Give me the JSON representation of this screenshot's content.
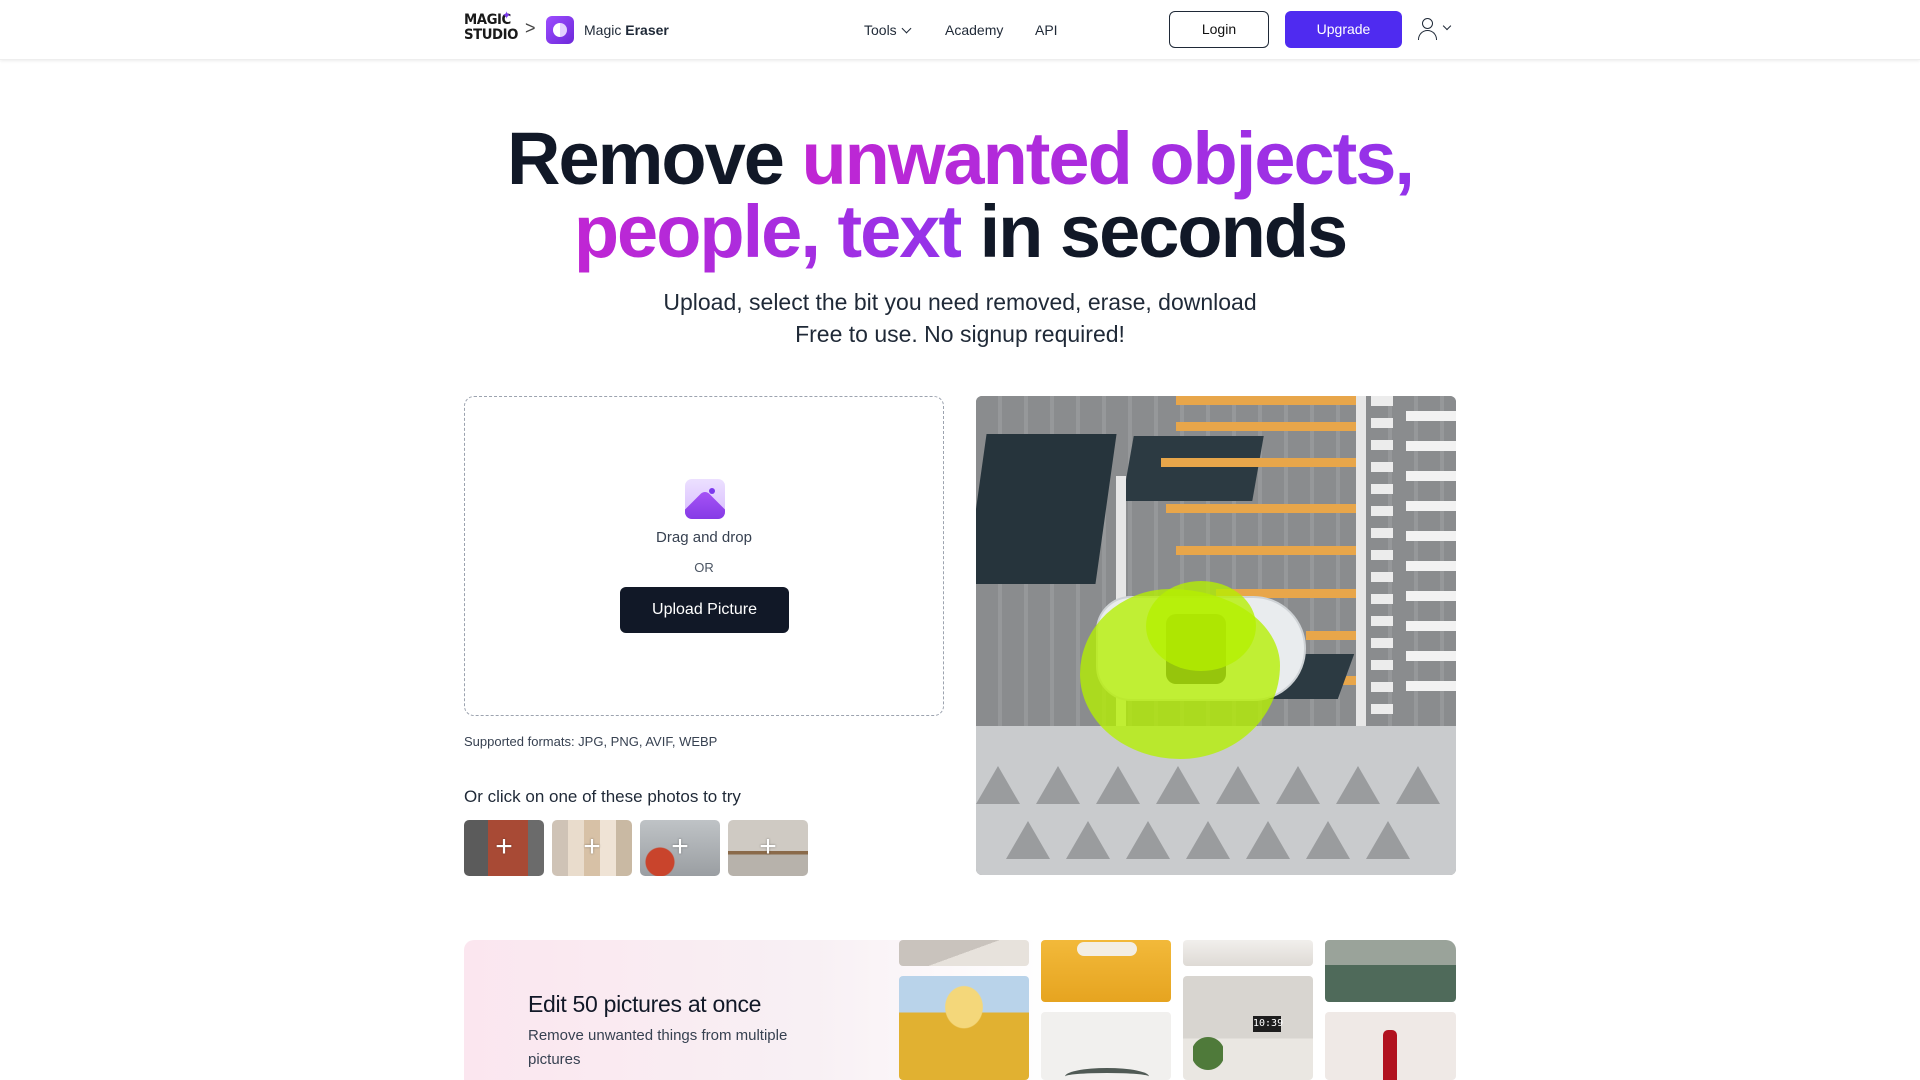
{
  "header": {
    "logo_line1": "MAGIC",
    "logo_line2": "STUDIO",
    "breadcrumb_separator": ">",
    "app_name_light": "Magic",
    "app_name_bold": "Eraser",
    "nav": {
      "tools": "Tools",
      "academy": "Academy",
      "api": "API"
    },
    "login": "Login",
    "upgrade": "Upgrade",
    "icons": [
      "sparkle-icon",
      "chevron-right-icon",
      "magic-eraser-app-icon",
      "chevron-down-icon",
      "user-icon"
    ]
  },
  "hero": {
    "title_part1": "Remove ",
    "title_highlight1": "unwanted objects,",
    "title_highlight2": "people, text",
    "title_part2": " in seconds",
    "subtitle_line1": "Upload, select the bit you need removed, erase, download",
    "subtitle_line2": "Free to use. No signup required!"
  },
  "upload": {
    "drag_text": "Drag and drop",
    "or_text": "OR",
    "button": "Upload Picture",
    "formats": "Supported formats: JPG, PNG, AVIF, WEBP",
    "icon": "image-upload-icon"
  },
  "samples": {
    "label": "Or click on one of these photos to try",
    "plus": "+",
    "items": [
      "sample-photo-1",
      "sample-photo-2",
      "sample-photo-3",
      "sample-photo-4"
    ]
  },
  "demo_image": {
    "clock_text": "10:39"
  },
  "promo": {
    "title": "Edit 50 pictures at once",
    "subtitle": "Remove unwanted things from multiple pictures"
  },
  "colors": {
    "accent": "#4f2bf0",
    "gradient_start": "#c026d3",
    "gradient_end": "#9333ea",
    "dark_button": "#111827",
    "erase_mask": "#b5f000"
  }
}
